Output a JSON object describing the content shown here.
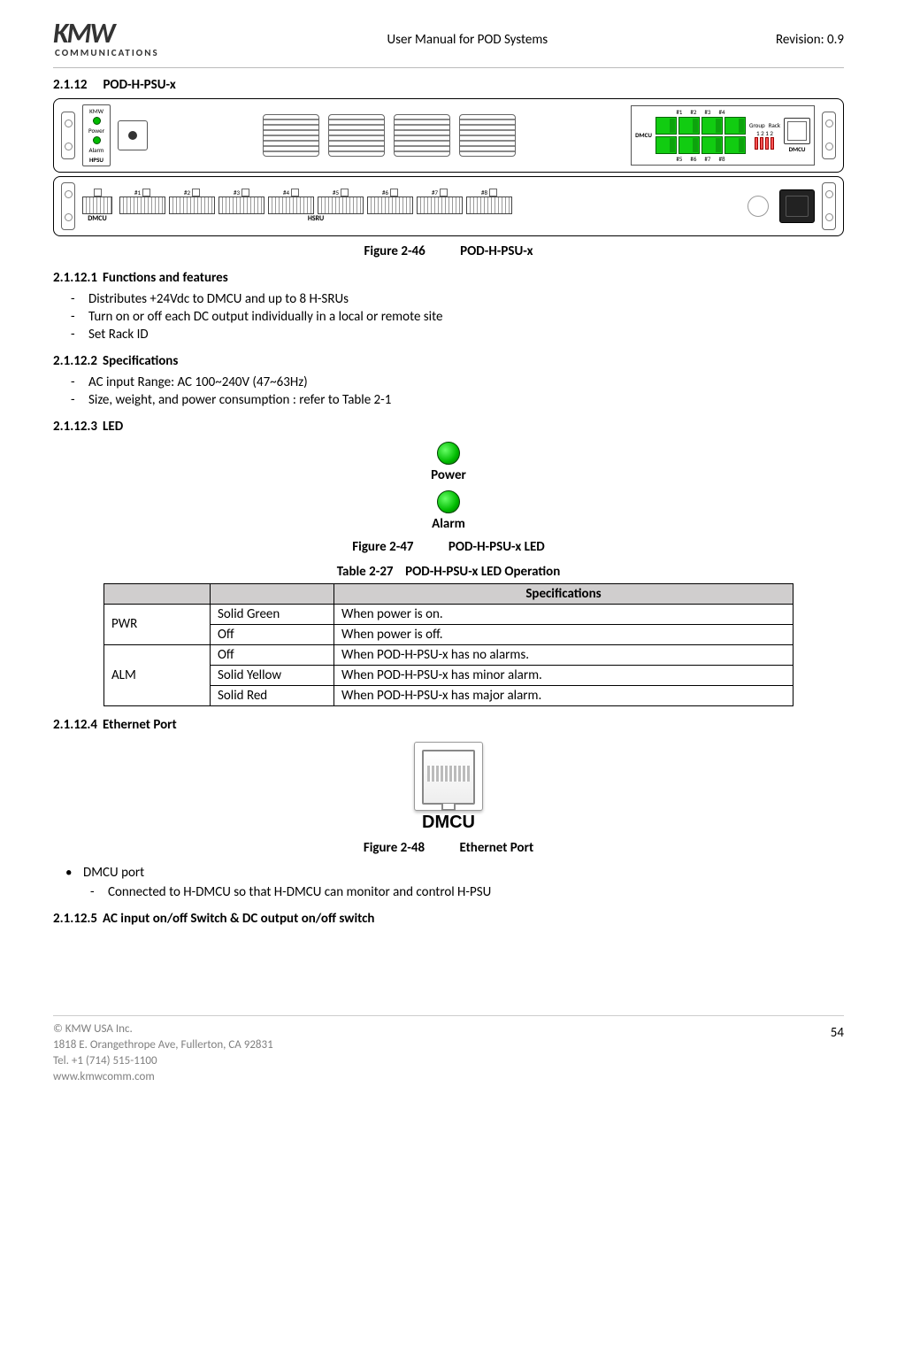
{
  "header": {
    "logo_top": "KMW",
    "logo_bottom": "COMMUNICATIONS",
    "center": "User Manual for POD Systems",
    "right": "Revision: 0.9"
  },
  "sections": {
    "s1": {
      "num": "2.1.12",
      "title": "POD-H-PSU-x"
    },
    "s1_1": {
      "num": "2.1.12.1",
      "title": "Functions and features"
    },
    "s1_2": {
      "num": "2.1.12.2",
      "title": "Specifications"
    },
    "s1_3": {
      "num": "2.1.12.3",
      "title": "LED"
    },
    "s1_4": {
      "num": "2.1.12.4",
      "title": "Ethernet Port"
    },
    "s1_5": {
      "num": "2.1.12.5",
      "title": "AC input on/off Switch & DC output on/off switch"
    }
  },
  "figures": {
    "f46": {
      "num": "Figure 2-46",
      "title": "POD-H-PSU-x"
    },
    "f47": {
      "num": "Figure 2-47",
      "title": "POD-H-PSU-x LED"
    },
    "f48": {
      "num": "Figure 2-48",
      "title": "Ethernet Port"
    }
  },
  "tables": {
    "t27": {
      "num": "Table 2-27",
      "title": "POD-H-PSU-x LED Operation"
    }
  },
  "bullets": {
    "func": [
      "Distributes +24Vdc to DMCU and up to 8 H-SRUs",
      "Turn on or off each DC output individually in a local or remote site",
      "Set Rack ID"
    ],
    "spec": [
      "AC input Range: AC 100~240V (47~63Hz)",
      "Size, weight, and power consumption : refer to Table 2-1"
    ],
    "dmcu_head": "DMCU port",
    "dmcu_sub": "Connected to H-DMCU so that H-DMCU can monitor and control H-PSU"
  },
  "led": {
    "power": "Power",
    "alarm": "Alarm"
  },
  "spec_table": {
    "header": "Specifications",
    "rows": [
      {
        "c0": "PWR",
        "c1": "Solid Green",
        "c2": "When power is on."
      },
      {
        "c0": "",
        "c1": "Off",
        "c2": "When power is off."
      },
      {
        "c0": "ALM",
        "c1": "Off",
        "c2": "When POD-H-PSU-x has no alarms."
      },
      {
        "c0": "",
        "c1": "Solid Yellow",
        "c2": "When POD-H-PSU-x has minor alarm."
      },
      {
        "c0": "",
        "c1": "Solid Red",
        "c2": "When POD-H-PSU-x has major alarm."
      }
    ]
  },
  "eth_label": "DMCU",
  "rack": {
    "front": {
      "kmw": "KMW",
      "power": "Power",
      "alarm": "Alarm",
      "hpsu": "HPSU",
      "dmcu": "DMCU",
      "group": "Group",
      "rack_lbl": "Rack",
      "dig": "1 2  1 2",
      "sw_top": [
        "#1",
        "#2",
        "#3",
        "#4"
      ],
      "sw_bot": [
        "#5",
        "#6",
        "#7",
        "#8"
      ]
    },
    "rear": {
      "dmcu": "DMCU",
      "hsru": "HSRU",
      "ports": [
        "#1",
        "#2",
        "#3",
        "#4",
        "#5",
        "#6",
        "#7",
        "#8"
      ]
    }
  },
  "footer": {
    "copy": "© KMW USA Inc.",
    "addr": "1818 E. Orangethrope Ave, Fullerton, CA 92831",
    "tel": "Tel. +1 (714) 515-1100",
    "web": "www.kmwcomm.com",
    "page": "54"
  }
}
